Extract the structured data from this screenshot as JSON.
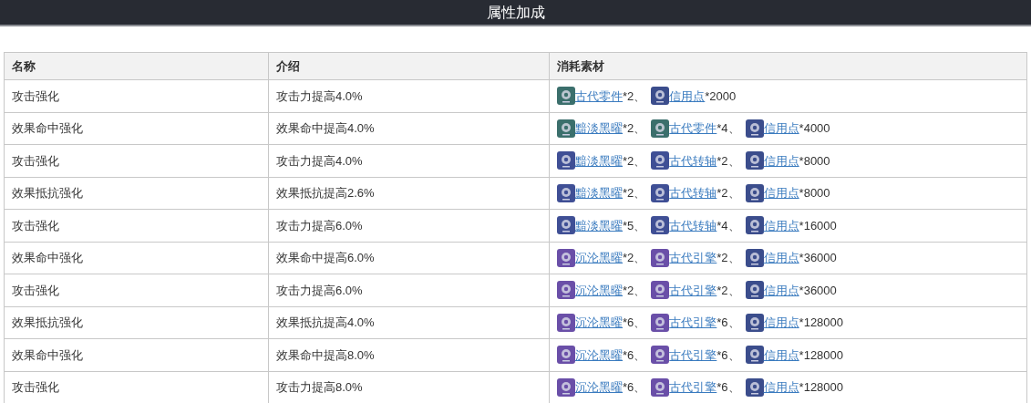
{
  "title": "属性加成",
  "columns": [
    "名称",
    "介绍",
    "消耗素材"
  ],
  "rows": [
    {
      "name": "攻击强化",
      "desc": "攻击力提高4.0%",
      "materials": [
        {
          "name": "古代零件",
          "suffix": "*2、",
          "color": "#3b6f6c"
        },
        {
          "name": "信用点",
          "suffix": "*2000",
          "color": "#3b4d8c"
        }
      ]
    },
    {
      "name": "效果命中强化",
      "desc": "效果命中提高4.0%",
      "materials": [
        {
          "name": "黯淡黑曜",
          "suffix": "*2、",
          "color": "#3b6f6c"
        },
        {
          "name": "古代零件",
          "suffix": "*4、",
          "color": "#3b6f6c"
        },
        {
          "name": "信用点",
          "suffix": "*4000",
          "color": "#3b4d8c"
        }
      ]
    },
    {
      "name": "攻击强化",
      "desc": "攻击力提高4.0%",
      "materials": [
        {
          "name": "黯淡黑曜",
          "suffix": "*2、",
          "color": "#3f4f95"
        },
        {
          "name": "古代转轴",
          "suffix": "*2、",
          "color": "#3f4f95"
        },
        {
          "name": "信用点",
          "suffix": "*8000",
          "color": "#3b4d8c"
        }
      ]
    },
    {
      "name": "效果抵抗强化",
      "desc": "效果抵抗提高2.6%",
      "materials": [
        {
          "name": "黯淡黑曜",
          "suffix": "*2、",
          "color": "#3f4f95"
        },
        {
          "name": "古代转轴",
          "suffix": "*2、",
          "color": "#3f4f95"
        },
        {
          "name": "信用点",
          "suffix": "*8000",
          "color": "#3b4d8c"
        }
      ]
    },
    {
      "name": "攻击强化",
      "desc": "攻击力提高6.0%",
      "materials": [
        {
          "name": "黯淡黑曜",
          "suffix": "*5、",
          "color": "#3f4f95"
        },
        {
          "name": "古代转轴",
          "suffix": "*4、",
          "color": "#3f4f95"
        },
        {
          "name": "信用点",
          "suffix": "*16000",
          "color": "#3b4d8c"
        }
      ]
    },
    {
      "name": "效果命中强化",
      "desc": "效果命中提高6.0%",
      "materials": [
        {
          "name": "沉沦黑曜",
          "suffix": "*2、",
          "color": "#6a4fa8"
        },
        {
          "name": "古代引擎",
          "suffix": "*2、",
          "color": "#6a4fa8"
        },
        {
          "name": "信用点",
          "suffix": "*36000",
          "color": "#3b4d8c"
        }
      ]
    },
    {
      "name": "攻击强化",
      "desc": "攻击力提高6.0%",
      "materials": [
        {
          "name": "沉沦黑曜",
          "suffix": "*2、",
          "color": "#6a4fa8"
        },
        {
          "name": "古代引擎",
          "suffix": "*2、",
          "color": "#6a4fa8"
        },
        {
          "name": "信用点",
          "suffix": "*36000",
          "color": "#3b4d8c"
        }
      ]
    },
    {
      "name": "效果抵抗强化",
      "desc": "效果抵抗提高4.0%",
      "materials": [
        {
          "name": "沉沦黑曜",
          "suffix": "*6、",
          "color": "#6a4fa8"
        },
        {
          "name": "古代引擎",
          "suffix": "*6、",
          "color": "#6a4fa8"
        },
        {
          "name": "信用点",
          "suffix": "*128000",
          "color": "#3b4d8c"
        }
      ]
    },
    {
      "name": "效果命中强化",
      "desc": "效果命中提高8.0%",
      "materials": [
        {
          "name": "沉沦黑曜",
          "suffix": "*6、",
          "color": "#6a4fa8"
        },
        {
          "name": "古代引擎",
          "suffix": "*6、",
          "color": "#6a4fa8"
        },
        {
          "name": "信用点",
          "suffix": "*128000",
          "color": "#3b4d8c"
        }
      ]
    },
    {
      "name": "攻击强化",
      "desc": "攻击力提高8.0%",
      "materials": [
        {
          "name": "沉沦黑曜",
          "suffix": "*6、",
          "color": "#6a4fa8"
        },
        {
          "name": "古代引擎",
          "suffix": "*6、",
          "color": "#6a4fa8"
        },
        {
          "name": "信用点",
          "suffix": "*128000",
          "color": "#3b4d8c"
        }
      ]
    }
  ]
}
